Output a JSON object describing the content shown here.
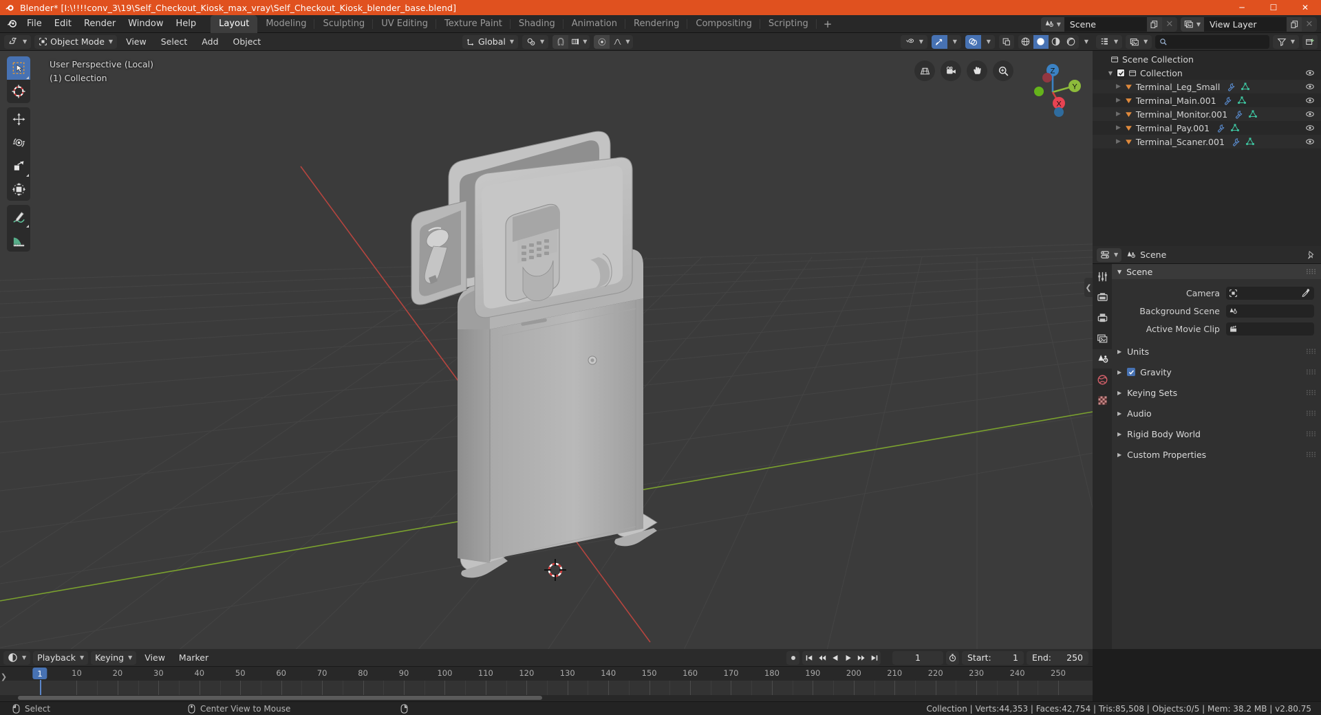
{
  "window": {
    "title": "Blender* [I:\\!!!!conv_3\\19\\Self_Checkout_Kiosk_max_vray\\Self_Checkout_Kiosk_blender_base.blend]",
    "app_icon": "blender-icon",
    "minimize": "─",
    "maximize": "☐",
    "close": "✕",
    "accent": "#e0511f"
  },
  "topbar": {
    "menus": [
      "File",
      "Edit",
      "Render",
      "Window",
      "Help"
    ],
    "workspaces": [
      {
        "label": "Layout",
        "active": true
      },
      {
        "label": "Modeling",
        "active": false
      },
      {
        "label": "Sculpting",
        "active": false
      },
      {
        "label": "UV Editing",
        "active": false
      },
      {
        "label": "Texture Paint",
        "active": false
      },
      {
        "label": "Shading",
        "active": false
      },
      {
        "label": "Animation",
        "active": false
      },
      {
        "label": "Rendering",
        "active": false
      },
      {
        "label": "Compositing",
        "active": false
      },
      {
        "label": "Scripting",
        "active": false
      }
    ],
    "add_workspace": "+",
    "scene": {
      "icon": "scene-icon",
      "name": "Scene",
      "new_btn": "new-scene-icon",
      "unlink_btn": "✕"
    },
    "view_layer": {
      "icon": "view-layer-icon",
      "name": "View Layer",
      "new_btn": "new-layer-icon",
      "unlink_btn": "✕"
    }
  },
  "viewport_header": {
    "editor_type": "editor-type-3dview",
    "mode": "Object Mode",
    "menus": [
      "View",
      "Select",
      "Add",
      "Object"
    ],
    "transform_orientation": "Global",
    "pivot_point": "pivot-icon",
    "snap_toggle": "magnet-icon",
    "snap_target": "snap-increment-icon",
    "proportional_edit": "proportional-edit-icon",
    "proportional_falloff": "falloff-smooth-icon",
    "visibility_icon": "visibility-icon",
    "gizmo_icon": "gizmo-icon",
    "overlays_icon": "overlays-icon",
    "xray_icon": "xray-icon",
    "shading_modes": [
      "wireframe",
      "solid",
      "material-preview",
      "rendered"
    ],
    "shading_active": "solid"
  },
  "viewport": {
    "perspective_label": "User Perspective (Local)",
    "collection_label": "(1) Collection",
    "toolbar": [
      {
        "name": "tweak-select-box-tool",
        "active": true
      },
      {
        "name": "cursor-tool",
        "active": false
      },
      {
        "name": "move-tool",
        "active": false
      },
      {
        "name": "rotate-tool",
        "active": false
      },
      {
        "name": "scale-tool",
        "active": false
      },
      {
        "name": "transform-tool",
        "active": false
      },
      {
        "name": "annotate-tool",
        "active": false
      },
      {
        "name": "measure-tool",
        "active": false
      }
    ],
    "nav_buttons": [
      "zoom-region-icon",
      "camera-view-icon",
      "pan-view-icon",
      "zoom-view-icon"
    ],
    "gizmo_axes": [
      "Z",
      "Y",
      "X"
    ],
    "colors": {
      "x_axis": "#cf4040",
      "y_axis": "#8dbb3b",
      "z_axis": "#3b82c4",
      "background": "#3b3b3b"
    }
  },
  "outliner": {
    "display_mode_icon": "outliner-view-layer-icon",
    "filter_id_icon": "blender-file-icon",
    "search_placeholder": "",
    "search_icon": "search-icon",
    "filter_icon": "filter-icon",
    "new_collection_icon": "new-collection-icon",
    "rows": [
      {
        "indent": 0,
        "label": "Scene Collection",
        "icon": "collection-icon",
        "tri": "",
        "checkbox": null,
        "has_eye": false,
        "obj_icons": []
      },
      {
        "indent": 1,
        "label": "Collection",
        "icon": "collection-icon",
        "tri": "▼",
        "checkbox": true,
        "has_eye": true,
        "obj_icons": []
      },
      {
        "indent": 2,
        "label": "Terminal_Leg_Small",
        "icon": "mesh-object-icon",
        "tri": "▶",
        "checkbox": null,
        "has_eye": true,
        "obj_icons": [
          "modifier-icon",
          "mesh-data-icon"
        ]
      },
      {
        "indent": 2,
        "label": "Terminal_Main.001",
        "icon": "mesh-object-icon",
        "tri": "▶",
        "checkbox": null,
        "has_eye": true,
        "obj_icons": [
          "modifier-icon",
          "mesh-data-icon"
        ]
      },
      {
        "indent": 2,
        "label": "Terminal_Monitor.001",
        "icon": "mesh-object-icon",
        "tri": "▶",
        "checkbox": null,
        "has_eye": true,
        "obj_icons": [
          "modifier-icon",
          "mesh-data-icon"
        ]
      },
      {
        "indent": 2,
        "label": "Terminal_Pay.001",
        "icon": "mesh-object-icon",
        "tri": "▶",
        "checkbox": null,
        "has_eye": true,
        "obj_icons": [
          "modifier-icon",
          "mesh-data-icon"
        ]
      },
      {
        "indent": 2,
        "label": "Terminal_Scaner.001",
        "icon": "mesh-object-icon",
        "tri": "▶",
        "checkbox": null,
        "has_eye": true,
        "obj_icons": [
          "modifier-icon",
          "mesh-data-icon"
        ]
      }
    ]
  },
  "properties": {
    "editor_icon": "properties-editor-icon",
    "breadcrumb_icon": "scene-icon",
    "breadcrumb": "Scene",
    "pin_icon": "pin-icon",
    "tabs": [
      {
        "name": "tool-tab",
        "active": false
      },
      {
        "name": "render-tab",
        "active": false
      },
      {
        "name": "output-tab",
        "active": false
      },
      {
        "name": "view-layer-tab",
        "active": false
      },
      {
        "name": "scene-tab",
        "active": true
      },
      {
        "name": "world-tab",
        "active": false
      },
      {
        "name": "texture-tab",
        "active": false
      }
    ],
    "panel_title": "Scene",
    "fields": [
      {
        "label": "Camera",
        "value": "",
        "icon": "camera-data-icon",
        "eyedropper": true
      },
      {
        "label": "Background Scene",
        "value": "",
        "icon": "scene-icon",
        "eyedropper": false
      },
      {
        "label": "Active Movie Clip",
        "value": "",
        "icon": "movie-clip-icon",
        "eyedropper": false
      }
    ],
    "sections": [
      {
        "label": "Units",
        "checkbox": null
      },
      {
        "label": "Gravity",
        "checkbox": true
      },
      {
        "label": "Keying Sets",
        "checkbox": null
      },
      {
        "label": "Audio",
        "checkbox": null
      },
      {
        "label": "Rigid Body World",
        "checkbox": null
      },
      {
        "label": "Custom Properties",
        "checkbox": null
      }
    ]
  },
  "timeline": {
    "editor_icon": "timeline-editor-icon",
    "menus": [
      "Playback",
      "Keying",
      "View",
      "Marker"
    ],
    "record_icon": "record-icon",
    "transport": [
      "jump-start-icon",
      "prev-keyframe-icon",
      "play-reverse-icon",
      "play-icon",
      "next-keyframe-icon",
      "jump-end-icon"
    ],
    "current_frame": "1",
    "auto_key_icon": "auto-keying-icon",
    "start_label": "Start:",
    "start_value": "1",
    "end_label": "End:",
    "end_value": "250",
    "ruler_ticks": [
      "1",
      "10",
      "20",
      "30",
      "40",
      "50",
      "60",
      "70",
      "80",
      "90",
      "100",
      "110",
      "120",
      "130",
      "140",
      "150",
      "160",
      "170",
      "180",
      "190",
      "200",
      "210",
      "220",
      "230",
      "240",
      "250"
    ],
    "playhead_frame": "1"
  },
  "statusbar": {
    "items": [
      {
        "icon": "mouse-left-icon",
        "label": "Select"
      },
      {
        "icon": "mouse-middle-icon",
        "label": "Center View to Mouse"
      },
      {
        "icon": "mouse-right-icon",
        "label": ""
      }
    ],
    "stats": "Collection | Verts:44,353 | Faces:42,754 | Tris:85,508 | Objects:0/5 | Mem: 38.2 MB | v2.80.75"
  }
}
